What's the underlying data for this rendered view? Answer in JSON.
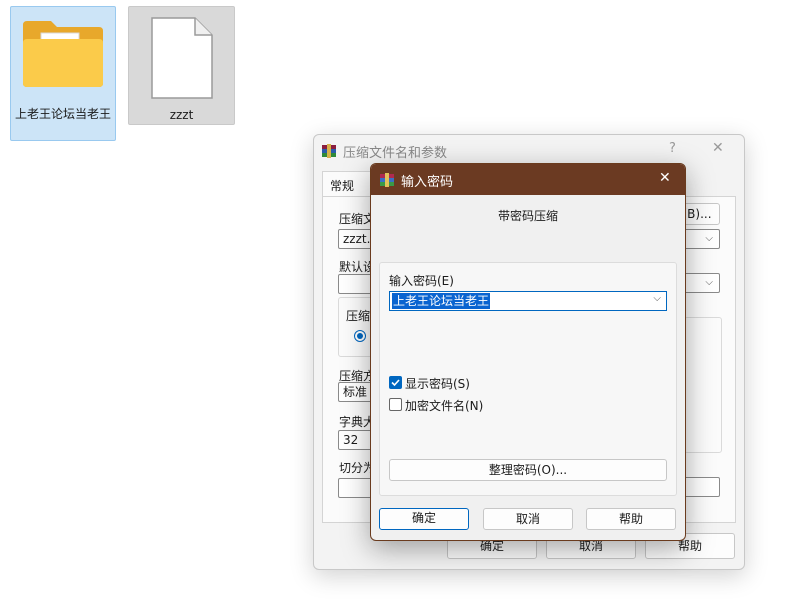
{
  "desktop": {
    "folder_label": "上老王论坛当老王",
    "file_label": "zzzt"
  },
  "back_window": {
    "title": "压缩文件名和参数",
    "help_glyph": "?",
    "close_glyph": "✕",
    "tab_general": "常规",
    "archive_name_label": "压缩文",
    "archive_name_value": "zzzt.ra",
    "browse_button": "(B)...",
    "default_label": "默认设",
    "format_label": "压缩",
    "method_label": "压缩方",
    "method_value": "标准",
    "dict_label": "字典大",
    "dict_value": "32",
    "split_label": "切分为",
    "right_paren": ")",
    "ok": "确定",
    "cancel": "取消",
    "help": "帮助"
  },
  "pw_dialog": {
    "title": "输入密码",
    "close_glyph": "✕",
    "heading": "带密码压缩",
    "enter_label": "输入密码(E)",
    "password_value": "上老王论坛当老王",
    "show_password": "显示密码(S)",
    "show_password_checked": true,
    "encrypt_names": "加密文件名(N)",
    "encrypt_names_checked": false,
    "organize_button": "整理密码(O)...",
    "ok": "确定",
    "cancel": "取消",
    "help": "帮助"
  },
  "colors": {
    "titlebar": "#6b3a22",
    "selection": "#0a64d0",
    "accent": "#0067c0"
  }
}
